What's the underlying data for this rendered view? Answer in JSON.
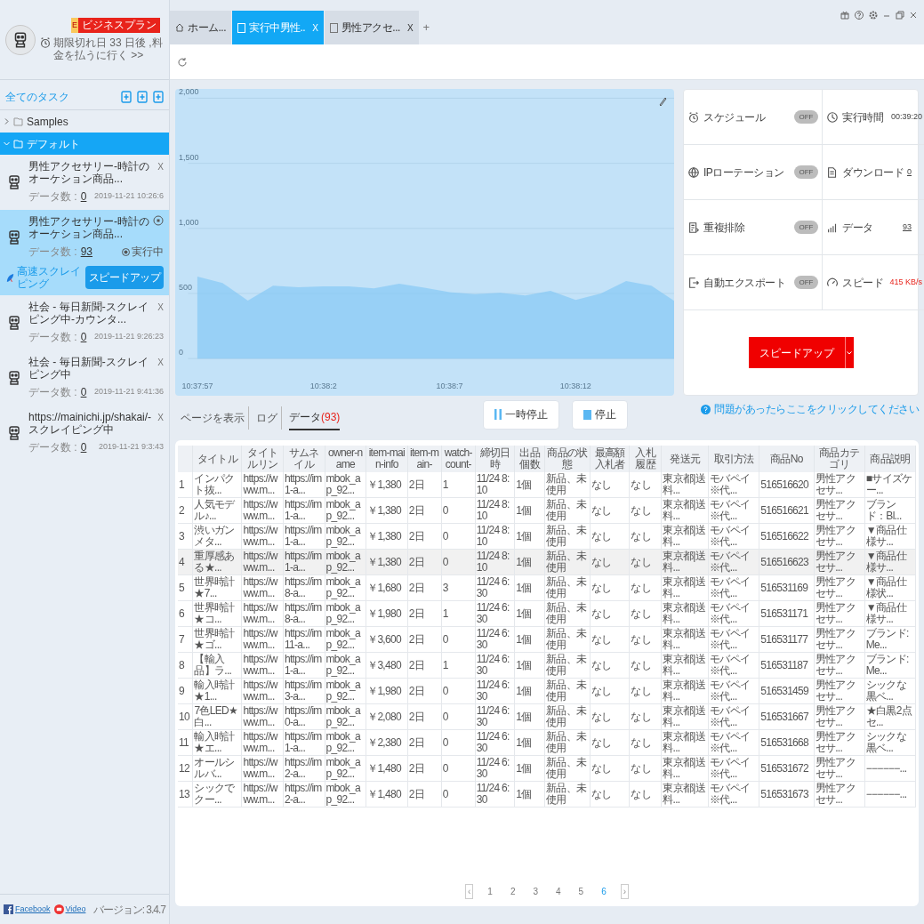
{
  "account": {
    "badge_letter": "E",
    "plan": "ビジネスプラン",
    "expiry": "期限切れ日 33 日後 ,料金を払うに行く >>"
  },
  "tabs": [
    {
      "label": "ホーム...",
      "kind": "home",
      "selected": false,
      "closable": false
    },
    {
      "label": "実行中男性..",
      "kind": "page",
      "selected": true,
      "closable": true,
      "close": "X"
    },
    {
      "label": "男性アクセ...",
      "kind": "page",
      "selected": false,
      "closable": true,
      "close": "X"
    }
  ],
  "new_tab": "+",
  "sidebar": {
    "title": "全てのタスク",
    "folders": [
      {
        "name": "Samples",
        "expanded": false,
        "selected": false
      },
      {
        "name": "デフォルト",
        "expanded": true,
        "selected": true,
        "children": [
          {
            "title": "男性アクセサリー-時計のオーケション商品...",
            "count_label": "データ数 :",
            "count": "0",
            "date": "2019-11-21 10:26:6",
            "running": false,
            "close": "X"
          },
          {
            "title": "男性アクセサリー-時計のオーケション商品...",
            "count_label": "データ数 :",
            "count": "93",
            "status": "実行中",
            "running": true,
            "mode": "高速スクレイピング",
            "boost": "スピードアップ"
          },
          {
            "title": "社会 - 毎日新聞-スクレイピング中-カウンタ...",
            "count_label": "データ数 :",
            "count": "0",
            "date": "2019-11-21 9:26:23",
            "running": false,
            "close": "X"
          },
          {
            "title": "社会 - 毎日新聞-スクレイピング中",
            "count_label": "データ数 :",
            "count": "0",
            "date": "2019-11-21 9:41:36",
            "running": false,
            "close": "X"
          },
          {
            "title": "https://mainichi.jp/shakai/-スクレイピング中",
            "count_label": "データ数 :",
            "count": "0",
            "date": "2019-11-21 9:3:43",
            "running": false,
            "close": "X"
          }
        ]
      }
    ]
  },
  "footer": {
    "links": [
      {
        "label": "Facebook",
        "kind": "facebook"
      },
      {
        "label": "Video",
        "kind": "video"
      }
    ],
    "version": "バージョン: 3.4.7"
  },
  "chart": {
    "chart_data": {
      "type": "area",
      "categories": [
        "10:37:57",
        null,
        null,
        null,
        null,
        "10:38:2",
        null,
        null,
        null,
        null,
        "10:38:7",
        null,
        null,
        null,
        null,
        "10:38:12",
        null,
        null,
        null,
        null
      ],
      "grid": true,
      "series": [
        {
          "color": "#7cc4f5",
          "values": [
            629,
            580,
            446,
            560,
            548,
            555,
            555,
            540,
            575,
            545,
            510,
            495,
            505,
            485,
            520,
            450,
            500,
            595,
            560,
            430
          ]
        }
      ],
      "ylim": [
        0,
        2000
      ],
      "yticks": [
        {
          "value": 0,
          "label": "0"
        },
        {
          "value": 500,
          "label": "500"
        },
        {
          "value": 1000,
          "label": "1,000"
        },
        {
          "value": 1500,
          "label": "1,500"
        },
        {
          "value": 2000,
          "label": "2,000"
        }
      ]
    }
  },
  "settings": [
    {
      "label": "スケジュール",
      "kind": "toggle",
      "on": false,
      "state": "OFF"
    },
    {
      "label": "IPローテーション",
      "kind": "toggle",
      "on": false,
      "state": "OFF"
    },
    {
      "label": "重複排除",
      "kind": "toggle",
      "on": false,
      "state": "OFF"
    },
    {
      "label": "自動エクスポート",
      "kind": "toggle",
      "on": false,
      "state": "OFF"
    }
  ],
  "stats": [
    {
      "label": "実行時間",
      "value": "00:39:20",
      "kind": "plain"
    },
    {
      "label": "ダウンロード",
      "value": "0",
      "kind": "link"
    },
    {
      "label": "データ",
      "value": "93",
      "kind": "link"
    },
    {
      "label": "スピード",
      "value": "415 KB/s",
      "kind": "alert"
    }
  ],
  "speed_button": "スピードアップ",
  "view_tabs": [
    {
      "label": "ページを表示",
      "selected": false
    },
    {
      "label": "ログ",
      "selected": false
    },
    {
      "label": "データ",
      "count": "(93)",
      "selected": true
    }
  ],
  "actions": [
    {
      "label": "一時停止",
      "kind": "pause"
    },
    {
      "label": "停止",
      "kind": "stop"
    }
  ],
  "help": "問題があったらここをクリックしてください",
  "table": {
    "columns": [
      "",
      "タイトル",
      "タイトルリン",
      "サムネイル",
      "owner-name",
      "item-main-info",
      "item-main-",
      "watch-count-",
      "締切日時",
      "出品個数",
      "商品の状態",
      "最高額入札者",
      "入札履歴",
      "発送元",
      "取引方法",
      "商品No",
      "商品カテゴリ",
      "商品説明"
    ],
    "rows": [
      {
        "selected": false,
        "cells": [
          "1",
          "インパクト抜...",
          "https://www.m...",
          "https://im1-a...",
          "mbok_ap_92...",
          "￥1,380",
          "2日",
          "1",
          "11/24 8:10",
          "1個",
          "新品、未使用",
          "なし",
          "なし",
          "東京都|送料...",
          "モバペイ ※代...",
          "516516620",
          "男性アクセサ...",
          "■サイズケー..."
        ]
      },
      {
        "selected": false,
        "cells": [
          "2",
          "人気モデル♪...",
          "https://www.m...",
          "https://im1-a...",
          "mbok_ap_92...",
          "￥1,380",
          "2日",
          "0",
          "11/24 8:10",
          "1個",
          "新品、未使用",
          "なし",
          "なし",
          "東京都|送料...",
          "モバペイ ※代...",
          "516516621",
          "男性アクセサ...",
          "ブランド：Bl..."
        ]
      },
      {
        "selected": false,
        "cells": [
          "3",
          "渋いガンメタ...",
          "https://www.m...",
          "https://im1-a...",
          "mbok_ap_92...",
          "￥1,380",
          "2日",
          "0",
          "11/24 8:10",
          "1個",
          "新品、未使用",
          "なし",
          "なし",
          "東京都|送料...",
          "モバペイ ※代...",
          "516516622",
          "男性アクセサ...",
          "▼商品仕様サ..."
        ]
      },
      {
        "selected": true,
        "cells": [
          "4",
          "重厚感ある★...",
          "https://www.m...",
          "https://im1-a...",
          "mbok_ap_92...",
          "￥1,380",
          "2日",
          "0",
          "11/24 8:10",
          "1個",
          "新品、未使用",
          "なし",
          "なし",
          "東京都|送料...",
          "モバペイ ※代...",
          "516516623",
          "男性アクセサ...",
          "▼商品仕様サ..."
        ]
      },
      {
        "selected": false,
        "cells": [
          "5",
          "世界時計★7...",
          "https://www.m...",
          "https://im8-a...",
          "mbok_ap_92...",
          "￥1,680",
          "2日",
          "3",
          "11/24 6:30",
          "1個",
          "新品、未使用",
          "なし",
          "なし",
          "東京都|送料...",
          "モバペイ ※代...",
          "516531169",
          "男性アクセサ...",
          "▼商品仕様状..."
        ]
      },
      {
        "selected": false,
        "cells": [
          "6",
          "世界時計★コ...",
          "https://www.m...",
          "https://im8-a...",
          "mbok_ap_92...",
          "￥1,980",
          "2日",
          "1",
          "11/24 6:30",
          "1個",
          "新品、未使用",
          "なし",
          "なし",
          "東京都|送料...",
          "モバペイ ※代...",
          "516531171",
          "男性アクセサ...",
          "▼商品仕様サ..."
        ]
      },
      {
        "selected": false,
        "cells": [
          "7",
          "世界時計★ゴ...",
          "https://www.m...",
          "https://im11-a...",
          "mbok_ap_92...",
          "￥3,600",
          "2日",
          "0",
          "11/24 6:30",
          "1個",
          "新品、未使用",
          "なし",
          "なし",
          "東京都|送料...",
          "モバペイ ※代...",
          "516531177",
          "男性アクセサ...",
          "ブランド:Me..."
        ]
      },
      {
        "selected": false,
        "cells": [
          "8",
          "【輸入品】ラ...",
          "https://www.m...",
          "https://im1-a...",
          "mbok_ap_92...",
          "￥3,480",
          "2日",
          "1",
          "11/24 6:30",
          "1個",
          "新品、未使用",
          "なし",
          "なし",
          "東京都|送料...",
          "モバペイ ※代...",
          "516531187",
          "男性アクセサ...",
          "ブランド:Me..."
        ]
      },
      {
        "selected": false,
        "cells": [
          "9",
          "輸入時計★1...",
          "https://www.m...",
          "https://im3-a...",
          "mbok_ap_92...",
          "￥1,980",
          "2日",
          "0",
          "11/24 6:30",
          "1個",
          "新品、未使用",
          "なし",
          "なし",
          "東京都|送料...",
          "モバペイ ※代...",
          "516531459",
          "男性アクセサ...",
          "シックな黒ベ..."
        ]
      },
      {
        "selected": false,
        "cells": [
          "10",
          "7色LED★白...",
          "https://www.m...",
          "https://im0-a...",
          "mbok_ap_92...",
          "￥2,080",
          "2日",
          "0",
          "11/24 6:30",
          "1個",
          "新品、未使用",
          "なし",
          "なし",
          "東京都|送料...",
          "モバペイ ※代...",
          "516531667",
          "男性アクセサ...",
          "★白黒2点セ..."
        ]
      },
      {
        "selected": false,
        "cells": [
          "11",
          "輸入時計★エ...",
          "https://www.m...",
          "https://im1-a...",
          "mbok_ap_92...",
          "￥2,380",
          "2日",
          "0",
          "11/24 6:30",
          "1個",
          "新品、未使用",
          "なし",
          "なし",
          "東京都|送料...",
          "モバペイ ※代...",
          "516531668",
          "男性アクセサ...",
          "シックな黒ベ..."
        ]
      },
      {
        "selected": false,
        "cells": [
          "12",
          "オールシルバ...",
          "https://www.m...",
          "https://im2-a...",
          "mbok_ap_92...",
          "￥1,480",
          "2日",
          "0",
          "11/24 6:30",
          "1個",
          "新品、未使用",
          "なし",
          "なし",
          "東京都|送料...",
          "モバペイ ※代...",
          "516531672",
          "男性アクセサ...",
          "−−−−−−..."
        ]
      },
      {
        "selected": false,
        "cells": [
          "13",
          "シックでクー...",
          "https://www.m...",
          "https://im2-a...",
          "mbok_ap_92...",
          "￥1,480",
          "2日",
          "0",
          "11/24 6:30",
          "1個",
          "新品、未使用",
          "なし",
          "なし",
          "東京都|送料...",
          "モバペイ ※代...",
          "516531673",
          "男性アクセサ...",
          "−−−−−−..."
        ]
      }
    ]
  },
  "pagination": {
    "prev": "‹",
    "next": "›",
    "pages": [
      {
        "label": "1",
        "selected": false
      },
      {
        "label": "2",
        "selected": false
      },
      {
        "label": "3",
        "selected": false
      },
      {
        "label": "4",
        "selected": false
      },
      {
        "label": "5",
        "selected": false
      },
      {
        "label": "6",
        "selected": true
      }
    ]
  }
}
